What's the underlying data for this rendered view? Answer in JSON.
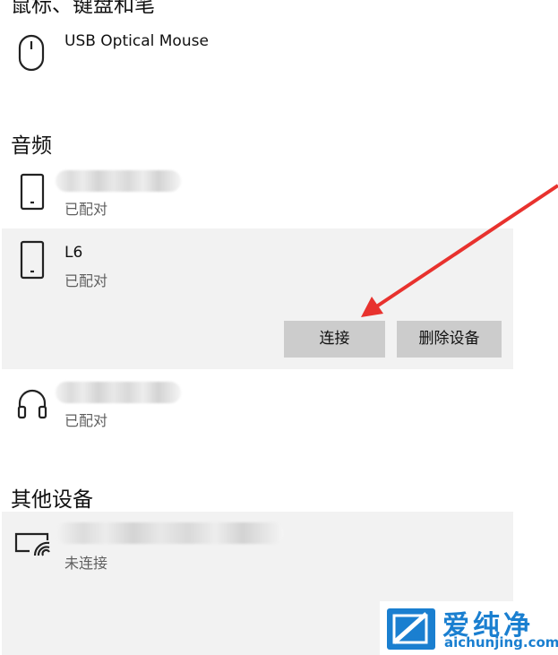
{
  "header_cut": "鼠标、键盘和笔",
  "mouse_device": {
    "name": "USB Optical Mouse",
    "icon": "mouse-icon"
  },
  "audio": {
    "title": "音频",
    "devices": [
      {
        "name": "",
        "status": "已配对",
        "icon": "phone-icon"
      },
      {
        "name": "L6",
        "status": "已配对",
        "icon": "phone-icon",
        "selected": true,
        "buttons": {
          "connect": "连接",
          "remove": "删除设备"
        }
      },
      {
        "name": "",
        "status": "已配对",
        "icon": "headphones-icon"
      }
    ]
  },
  "other": {
    "title": "其他设备",
    "devices": [
      {
        "name": "",
        "status": "未连接",
        "icon": "display-wireless-icon"
      }
    ]
  },
  "watermark": {
    "brand": "爱纯净",
    "url": "aichunjing.com",
    "accent": "#1a7fd0"
  },
  "colors": {
    "selected_bg": "#f2f2f2",
    "button_bg": "#cccccc",
    "annotation_arrow": "#e8322e"
  }
}
